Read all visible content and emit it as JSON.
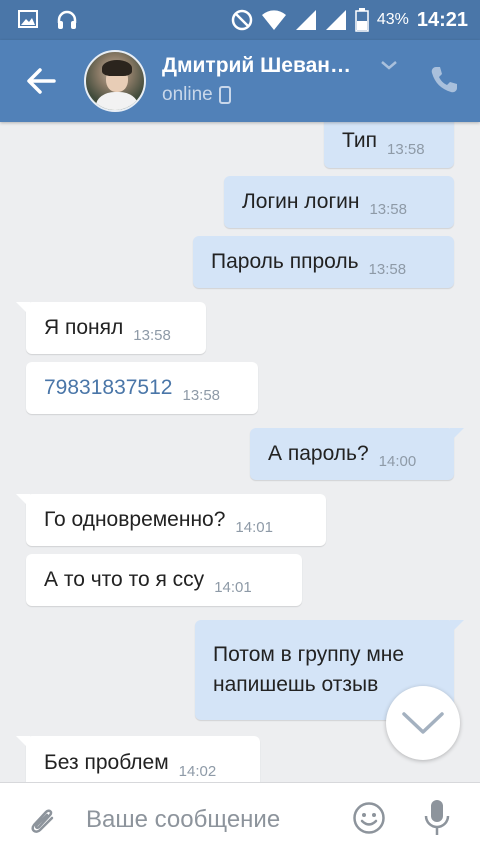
{
  "status_bar": {
    "battery": "43%",
    "time": "14:21"
  },
  "header": {
    "contact_name": "Дмитрий Шеван…",
    "status": "online"
  },
  "messages": [
    {
      "direction": "out",
      "text": "Тип",
      "time": "13:58"
    },
    {
      "direction": "out",
      "text": "Логин логин",
      "time": "13:58"
    },
    {
      "direction": "out",
      "text": "Пароль ппроль",
      "time": "13:58"
    },
    {
      "direction": "in",
      "text": "Я понял",
      "time": "13:58"
    },
    {
      "direction": "in",
      "text": "79831837512",
      "time": "13:58"
    },
    {
      "direction": "out",
      "text": "А пароль?",
      "time": "14:00"
    },
    {
      "direction": "in",
      "text": "Го одновременно?",
      "time": "14:01"
    },
    {
      "direction": "in",
      "text": "А то что то я ссу",
      "time": "14:01"
    },
    {
      "direction": "out",
      "text": "Потом в группу мне напишешь отзыв",
      "time": ""
    },
    {
      "direction": "in",
      "text": "Без проблем",
      "time": "14:02"
    }
  ],
  "composer": {
    "placeholder": "Ваше сообщение"
  }
}
